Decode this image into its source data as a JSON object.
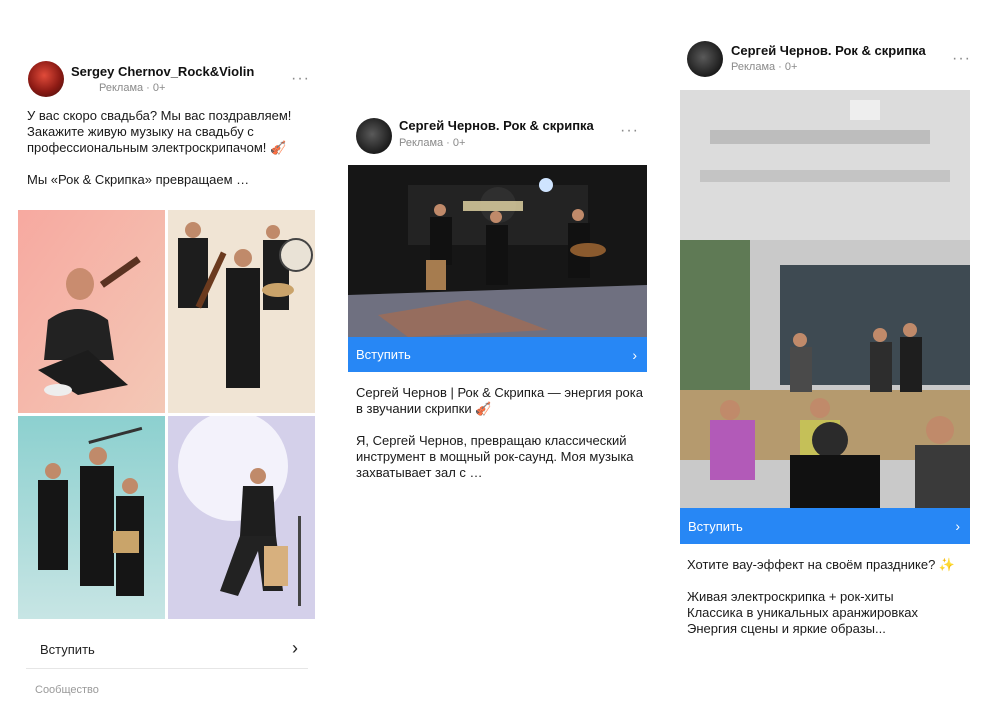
{
  "cards": [
    {
      "author": "Sergey Chernov_Rock&Violin",
      "meta": "Реклама · 0+",
      "more": "···",
      "text": "У вас скоро свадьба? Мы вас поздравляем! Закажите живую музыку на свадьбу с профессиональным электроскрипачом! 🎻\n\nМы «Рок & Скрипка» превращаем …",
      "cta_label": "Вступить",
      "cta_chevron": "›",
      "footer": "Сообщество"
    },
    {
      "author": "Сергей Чернов. Рок & скрипка",
      "meta": "Реклама · 0+",
      "more": "···",
      "cta_label": "Вступить",
      "cta_chevron": "›",
      "text": "Сергей Чернов | Рок & Скрипка — энергия рока в звучании скрипки 🎻\n\nЯ, Сергей Чернов, превращаю классический инструмент в мощный рок-саунд. Моя музыка захватывает зал с …"
    },
    {
      "author": "Сергей Чернов. Рок & скрипка",
      "meta": "Реклама · 0+",
      "more": "···",
      "cta_label": "Вступить",
      "cta_chevron": "›",
      "text": "Хотите вау-эффект на своём празднике? ✨\n\nЖивая электроскрипка + рок-хиты\nКлассика в уникальных аранжировках\nЭнергия сцены и яркие образы..."
    }
  ],
  "colors": {
    "cta_blue": "#2787f5",
    "meta_gray": "#8a8a8a"
  }
}
